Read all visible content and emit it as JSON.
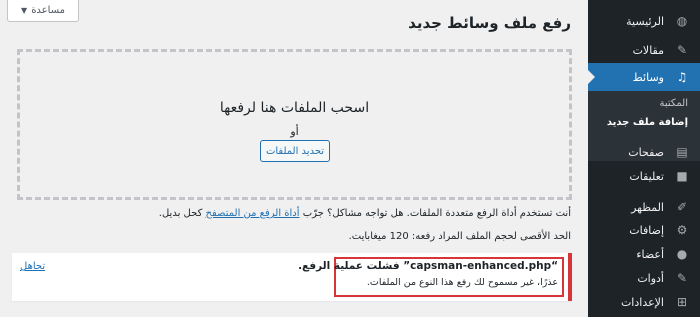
{
  "sidebar": {
    "items": [
      {
        "label": "الرئيسية",
        "icon": "dashboard-icon"
      },
      {
        "label": "مقالات",
        "icon": "pin-icon"
      },
      {
        "label": "وسائط",
        "icon": "media-icon"
      },
      {
        "label": "صفحات",
        "icon": "pages-icon"
      },
      {
        "label": "تعليقات",
        "icon": "comments-icon"
      },
      {
        "label": "المظهر",
        "icon": "appearance-icon"
      },
      {
        "label": "إضافات",
        "icon": "plugins-icon"
      },
      {
        "label": "أعضاء",
        "icon": "users-icon"
      },
      {
        "label": "أدوات",
        "icon": "tools-icon"
      },
      {
        "label": "الإعدادات",
        "icon": "settings-icon"
      }
    ],
    "submenu": [
      {
        "label": "المكتبة"
      },
      {
        "label": "إضافة ملف جديد"
      }
    ],
    "active_color": "#2271b1"
  },
  "header": {
    "help_label": "مساعدة",
    "title": "رفع ملف وسائط جديد"
  },
  "upload": {
    "drop_title": "اسحب الملفات هنا لرفعها",
    "or_text": "أو",
    "select_button": "تحديد الملفات",
    "multi_uploader_text": "أنت تستخدم أداة الرفع متعددة الملفات. هل تواجه مشاكل؟ جرّب",
    "browser_uploader_link": "أداة الرفع من المتصفح",
    "alt_text": "كحل بديل.",
    "max_size": "الحد الأقصى لحجم الملف المراد رفعه: 120 ميغابايت."
  },
  "error": {
    "title": "“capsman-enhanced.php” فشلت عملية الرفع.",
    "message": "عذرًا، غير مسموح لك رفع هذا النوع من الملفات.",
    "dismiss": "تجاهل",
    "color": "#d63638"
  }
}
